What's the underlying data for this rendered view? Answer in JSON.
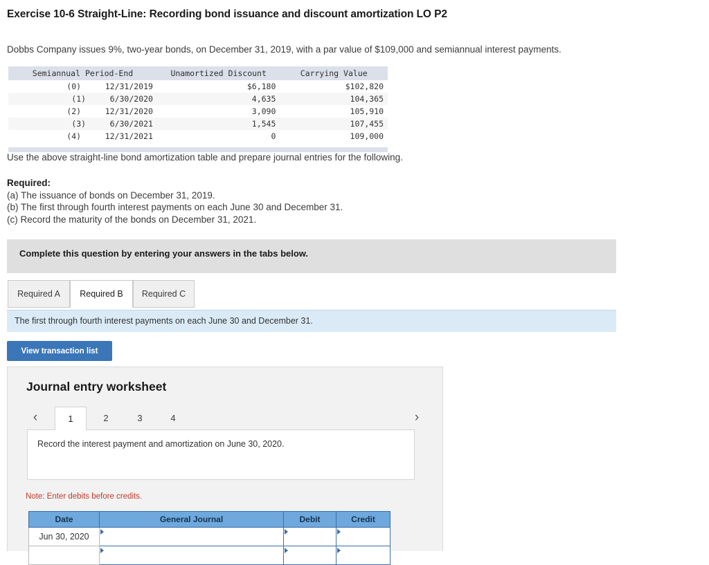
{
  "exercise": {
    "title": "Exercise 10-6 Straight-Line: Recording bond issuance and discount amortization LO P2",
    "intro": "Dobbs Company issues 9%, two-year bonds, on December 31, 2019, with a par value of $109,000 and semiannual interest payments.",
    "use_above": "Use the above straight-line bond amortization table and prepare journal entries for the following."
  },
  "amortization_table": {
    "headers": [
      "Semiannual Period-End",
      "Unamortized Discount",
      "Carrying Value"
    ],
    "rows": [
      {
        "index": "(0)",
        "period_end": "12/31/2019",
        "unamortized_discount": "$6,180",
        "carrying_value": "$102,820"
      },
      {
        "index": "(1)",
        "period_end": "6/30/2020",
        "unamortized_discount": "4,635",
        "carrying_value": "104,365"
      },
      {
        "index": "(2)",
        "period_end": "12/31/2020",
        "unamortized_discount": "3,090",
        "carrying_value": "105,910"
      },
      {
        "index": "(3)",
        "period_end": "6/30/2021",
        "unamortized_discount": "1,545",
        "carrying_value": "107,455"
      },
      {
        "index": "(4)",
        "period_end": "12/31/2021",
        "unamortized_discount": "0",
        "carrying_value": "109,000"
      }
    ]
  },
  "required": {
    "heading": "Required:",
    "items": [
      "(a) The issuance of bonds on December 31, 2019.",
      "(b) The first through fourth interest payments on each June 30 and December 31.",
      "(c) Record the maturity of the bonds on December 31, 2021."
    ]
  },
  "complete_banner": {
    "text": "Complete this question by entering your answers in the tabs below."
  },
  "required_tabs": {
    "items": [
      {
        "label": "Required A",
        "active": false
      },
      {
        "label": "Required B",
        "active": true
      },
      {
        "label": "Required C",
        "active": false
      }
    ]
  },
  "instruction_bar": {
    "text": "The first through fourth interest payments on each June 30 and December 31."
  },
  "toolbar": {
    "view_transaction_list_label": "View transaction list"
  },
  "worksheet": {
    "title": "Journal entry worksheet",
    "pager": {
      "prev_icon": "‹",
      "next_icon": "›",
      "pages": [
        {
          "label": "1",
          "active": true
        },
        {
          "label": "2",
          "active": false
        },
        {
          "label": "3",
          "active": false
        },
        {
          "label": "4",
          "active": false
        }
      ]
    },
    "record_instruction": "Record the interest payment and amortization on June 30, 2020.",
    "note": "Note: Enter debits before credits.",
    "journal_table": {
      "headers": [
        "Date",
        "General Journal",
        "Debit",
        "Credit"
      ],
      "rows": [
        {
          "date": "Jun 30, 2020",
          "general_journal": "",
          "debit": "",
          "credit": ""
        },
        {
          "date": "",
          "general_journal": "",
          "debit": "",
          "credit": ""
        }
      ]
    }
  },
  "colors": {
    "accent_blue": "#3a76b8",
    "table_header_blue": "#6ea8dc",
    "instruction_bar_blue": "#daebf7",
    "banner_grey": "#dfdfdf",
    "amort_header_grey": "#dbe0ea",
    "note_red": "#c0392b"
  }
}
